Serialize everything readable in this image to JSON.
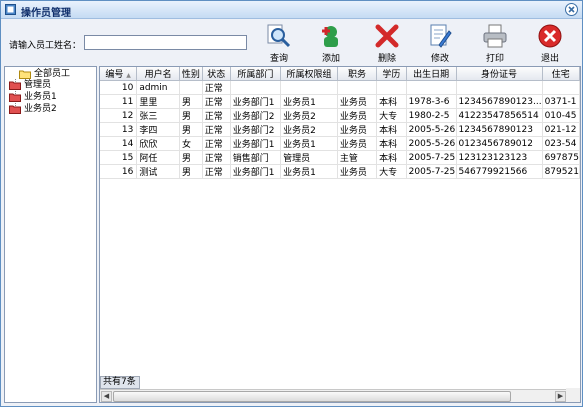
{
  "window": {
    "title": "操作员管理"
  },
  "search": {
    "label": "请输入员工姓名：",
    "value": ""
  },
  "toolbar": [
    {
      "name": "query-button",
      "icon": "magnifier-icon",
      "label": "查询"
    },
    {
      "name": "add-button",
      "icon": "add-user-icon",
      "label": "添加"
    },
    {
      "name": "delete-button",
      "icon": "delete-x-icon",
      "label": "删除"
    },
    {
      "name": "edit-button",
      "icon": "edit-document-icon",
      "label": "修改"
    },
    {
      "name": "print-button",
      "icon": "printer-icon",
      "label": "打印"
    },
    {
      "name": "exit-button",
      "icon": "exit-icon",
      "label": "退出"
    }
  ],
  "tree": {
    "items": [
      {
        "label": "全部员工",
        "icon": "folder-open-icon"
      },
      {
        "label": "管理员",
        "icon": "folder-red-icon"
      },
      {
        "label": "业务员1",
        "icon": "folder-red-icon"
      },
      {
        "label": "业务员2",
        "icon": "folder-red-icon"
      }
    ]
  },
  "table": {
    "columns": [
      "编号",
      "用户名",
      "性别",
      "状态",
      "所属部门",
      "所属权限组",
      "职务",
      "学历",
      "出生日期",
      "身份证号",
      "住宅"
    ],
    "sort_indicator": "▲",
    "rows": [
      [
        "10",
        "admin",
        "",
        "正常",
        "",
        "",
        "",
        "",
        "",
        "",
        ""
      ],
      [
        "11",
        "里里",
        "男",
        "正常",
        "业务部门1",
        "业务员1",
        "业务员",
        "本科",
        "1978-3-6",
        "1234567890123...",
        "0371-1"
      ],
      [
        "12",
        "张三",
        "男",
        "正常",
        "业务部门2",
        "业务员2",
        "业务员",
        "大专",
        "1980-2-5",
        "41223547856514",
        "010-45"
      ],
      [
        "13",
        "李四",
        "男",
        "正常",
        "业务部门2",
        "业务员2",
        "业务员",
        "本科",
        "2005-5-26",
        "1234567890123",
        "021-12"
      ],
      [
        "14",
        "欣欣",
        "女",
        "正常",
        "业务部门1",
        "业务员1",
        "业务员",
        "本科",
        "2005-5-26",
        "0123456789012",
        "023-54"
      ],
      [
        "15",
        "阿任",
        "男",
        "正常",
        "销售部门",
        "管理员",
        "主管",
        "本科",
        "2005-7-25",
        "123123123123",
        "697875"
      ],
      [
        "16",
        "测试",
        "男",
        "正常",
        "业务部门1",
        "业务员1",
        "业务员",
        "大专",
        "2005-7-25",
        "546779921566",
        "879521"
      ]
    ]
  },
  "footer": {
    "count_text": "共有7条"
  }
}
